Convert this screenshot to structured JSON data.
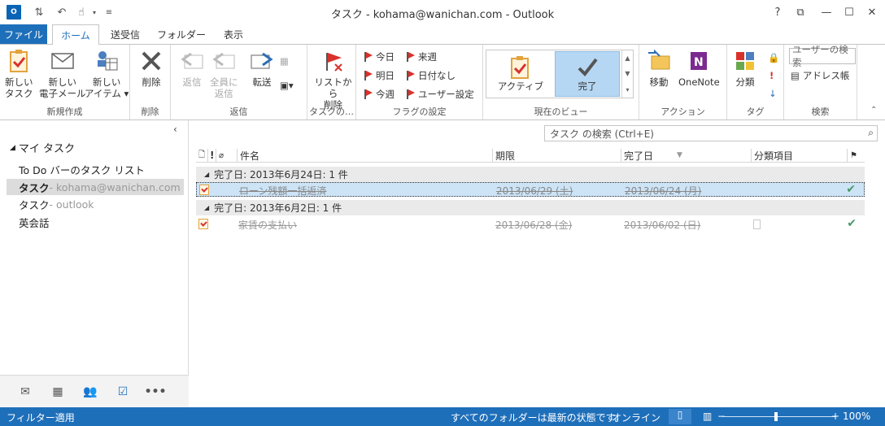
{
  "title": "タスク - kohama@wanichan.com - Outlook",
  "qat": {
    "app_icon": "O",
    "window_controls": [
      "?",
      "⧉",
      "—",
      "☐",
      "✕"
    ]
  },
  "tabs": [
    {
      "label": "ファイル"
    },
    {
      "label": "ホーム"
    },
    {
      "label": "送受信"
    },
    {
      "label": "フォルダー"
    },
    {
      "label": "表示"
    }
  ],
  "ribbon": {
    "groups": {
      "new": "新規作成",
      "delete": "削除",
      "reply": "返信",
      "task": "タスクの…",
      "flag": "フラグの設定",
      "view": "現在のビュー",
      "action": "アクション",
      "tag": "タグ",
      "search": "検索"
    },
    "new_task": [
      "新しい",
      "タスク"
    ],
    "new_email": [
      "新しい",
      "電子メール"
    ],
    "new_item": [
      "新しい",
      "アイテム ▾"
    ],
    "delete": "削除",
    "reply": "返信",
    "reply_all": [
      "全員に",
      "返信"
    ],
    "forward": "転送",
    "remove_from_list": [
      "リストから",
      "削除"
    ],
    "flags": {
      "today": "今日",
      "tomorrow": "明日",
      "this_week": "今週",
      "next_week": "来週",
      "no_date": "日付なし",
      "custom": "ユーザー設定"
    },
    "view_active": "アクティブ",
    "view_completed": "完了",
    "move": "移動",
    "onenote": "OneNote",
    "categorize": "分類",
    "search_people": "ユーザーの検索",
    "address_book": "アドレス帳"
  },
  "nav": {
    "header": "マイ タスク",
    "items": [
      {
        "label": "To Do バーのタスク リスト",
        "sub": ""
      },
      {
        "label": "タスク",
        "sub": " - kohama@wanichan.com"
      },
      {
        "label": "タスク",
        "sub": " - outlook"
      },
      {
        "label": "英会話",
        "sub": ""
      }
    ]
  },
  "search": {
    "placeholder": "タスク の検索 (Ctrl+E)"
  },
  "columns": {
    "subject": "件名",
    "due": "期限",
    "completed": "完了日",
    "category": "分類項目"
  },
  "groups": [
    {
      "label": "完了日: 2013年6月24日: 1 件",
      "tasks": [
        {
          "subject": "ローン残額一括返済",
          "due": "2013/06/29 (土)",
          "completed": "2013/06/24 (月)"
        }
      ]
    },
    {
      "label": "完了日: 2013年6月2日: 1 件",
      "tasks": [
        {
          "subject": "家賃の支払い",
          "due": "2013/06/28 (金)",
          "completed": "2013/06/02 (日)"
        }
      ]
    }
  ],
  "status": {
    "filter": "フィルター適用",
    "folders": "すべてのフォルダーは最新の状態です。",
    "online": "オンライン",
    "zoom": "100%"
  }
}
